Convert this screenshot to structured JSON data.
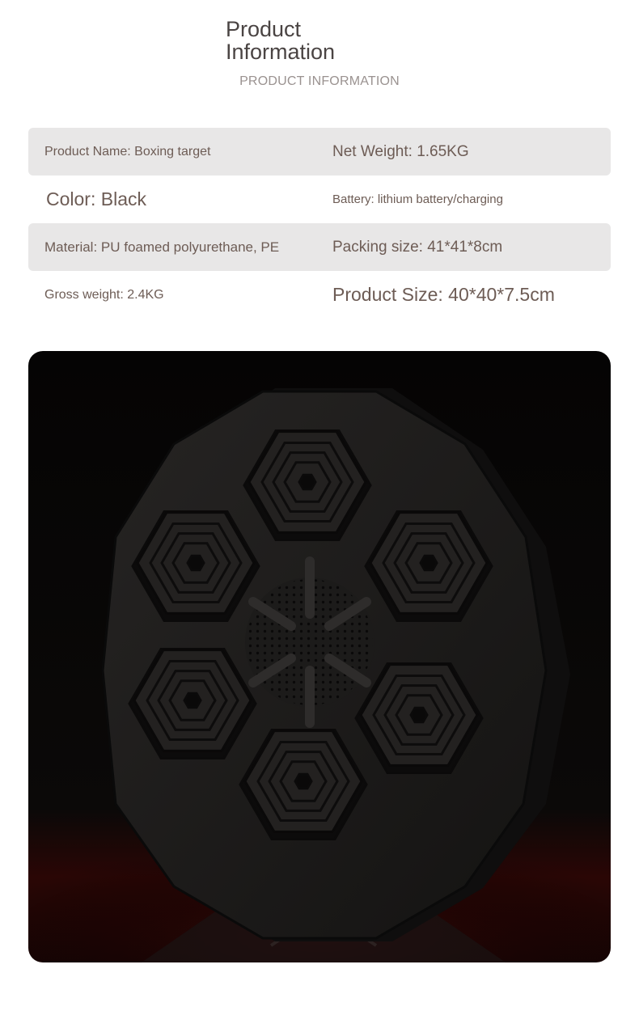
{
  "header": {
    "title": "Product\nInformation",
    "subtitle": "PRODUCT INFORMATION"
  },
  "specs": [
    {
      "left": "Product Name: Boxing target",
      "right": "Net Weight: 1.65KG"
    },
    {
      "left": "Color: Black",
      "right": "Battery: lithium battery/charging"
    },
    {
      "left": "Material: PU foamed polyurethane, PE",
      "right": "Packing size: 41*41*8cm"
    },
    {
      "left": "Gross weight: 2.4KG",
      "right": "Product Size: 40*40*7.5cm"
    }
  ],
  "colors": {
    "text": "#6d5c55",
    "row_shade": "#e8e7e7",
    "product": "#1a1817",
    "backdrop_red": "#2a0605"
  }
}
